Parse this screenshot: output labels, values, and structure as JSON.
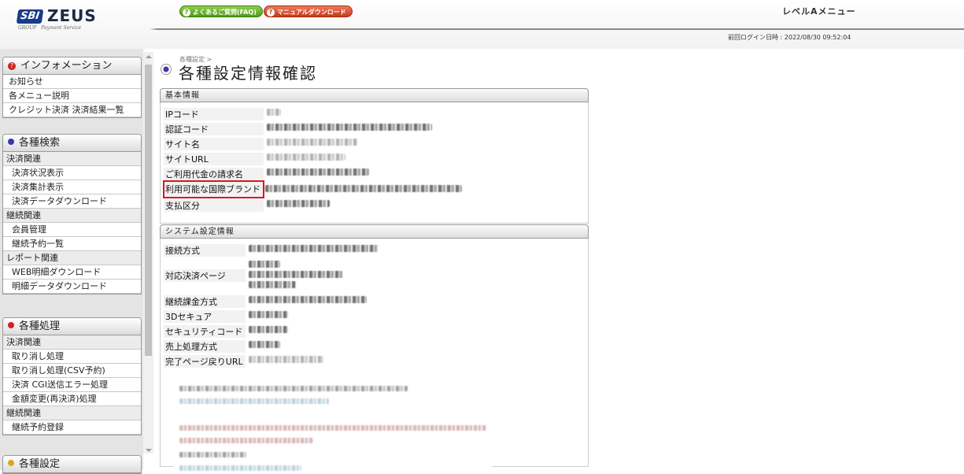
{
  "header": {
    "logo_brand": "SBI",
    "logo_name": "ZEUS",
    "logo_group": "GROUP",
    "logo_service": "Payment Service",
    "faq_label": "よくあるご質問(FAQ)",
    "manual_label": "マニュアルダウンロード",
    "level_menu": "レベルAメニュー",
    "last_login": "前回ログイン日時 : 2022/08/30 09:52:04"
  },
  "sidebar": {
    "info": {
      "title": "インフォメーション",
      "items": [
        "お知らせ",
        "各メニュー説明",
        "クレジット決済 決済結果一覧"
      ]
    },
    "search": {
      "title": "各種検索",
      "cat1": "決済関連",
      "items1": [
        "決済状況表示",
        "決済集計表示",
        "決済データダウンロード"
      ],
      "cat2": "継続関連",
      "items2": [
        "会員管理",
        "継続予約一覧"
      ],
      "cat3": "レポート関連",
      "items3": [
        "WEB明細ダウンロード",
        "明細データダウンロード"
      ]
    },
    "process": {
      "title": "各種処理",
      "cat1": "決済関連",
      "items1": [
        "取り消し処理",
        "取り消し処理(CSV予約)",
        "決済 CGI送信エラー処理",
        "金額変更(再決済)処理"
      ],
      "cat2": "継続関連",
      "items2": [
        "継続予約登録"
      ]
    },
    "setting": {
      "title": "各種設定"
    }
  },
  "main": {
    "breadcrumb": "各種設定 >",
    "title": "各種設定情報確認",
    "basic": {
      "heading": "基本情報",
      "rows": [
        "IPコード",
        "認証コード",
        "サイト名",
        "サイトURL",
        "ご利用代金の請求名",
        "利用可能な国際ブランド",
        "支払区分"
      ]
    },
    "system": {
      "heading": "システム設定情報",
      "rows": [
        "接続方式",
        "対応決済ページ",
        "継続課金方式",
        "3Dセキュア",
        "セキュリティコード",
        "売上処理方式",
        "完了ページ戻りURL"
      ]
    }
  },
  "colors": {
    "highlight": "#e0131d",
    "faq_button": "#4f9a1a",
    "manual_button": "#c43a1a",
    "bullet_blue": "#3a3aa8"
  }
}
